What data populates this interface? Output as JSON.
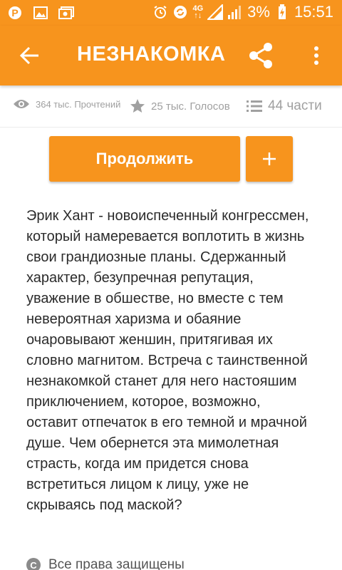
{
  "status_bar": {
    "network": "4G",
    "battery": "3%",
    "time": "15:51",
    "left_icons": [
      "pinterest-icon",
      "image-icon",
      "photo-stack-icon"
    ],
    "right_icons": [
      "alarm-icon",
      "sync-icon",
      "signal-icon",
      "battery-charging-icon"
    ]
  },
  "app_bar": {
    "title": "НЕЗНАКОМКА"
  },
  "stats": {
    "reads": "364 тыс. Прочтений",
    "votes": "25 тыс. Голосов",
    "parts": "44 части"
  },
  "actions": {
    "continue_label": "Продолжить",
    "add_label": "+"
  },
  "description": "Эрик Хант - новоиспеченный конгрессмен, который намеревается воплотить в жизнь свои грандиозные планы. Сдержанный характер, безупречная репутация, уважение в обшестве, но вместе с тем невероятная харизма и обаяние очаровывают женшин, притягивая их словно магнитом. Встреча с таинственной незнакомкой станет для него настояшим приключением, которое, возможно, оставит отпечаток в его темной и мрачной душе. Чем обернется эта мимолетная страсть, когда им придется снова встретиться лицом к лицу, уже не скрываясь под маской?",
  "copyright": "Все права защищены",
  "colors": {
    "accent": "#f7941d",
    "stat_text": "#a0a0a0",
    "body_text": "#2b2b2b"
  }
}
